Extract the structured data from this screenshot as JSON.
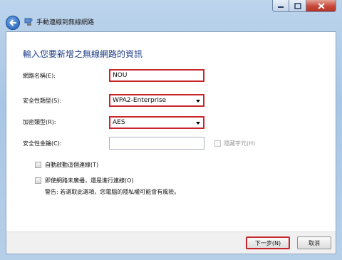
{
  "window": {
    "title": "手動連線到無線網路",
    "controls": [
      "minimize",
      "maximize",
      "close"
    ]
  },
  "heading": "輸入您要新增之無線網路的資訊",
  "form": {
    "network_name": {
      "label": "網路名稱(E):",
      "value": "NOU"
    },
    "security_type": {
      "label": "安全性類型(S):",
      "value": "WPA2-Enterprise"
    },
    "encryption_type": {
      "label": "加密類型(R):",
      "value": "AES"
    },
    "security_key": {
      "label": "安全性金鑰(C):",
      "value": ""
    },
    "hide_chars": {
      "label": "隱藏字元(H)",
      "checked": false,
      "enabled": false
    }
  },
  "options": {
    "auto_start": {
      "label": "自動啟動這個連線(T)",
      "checked": false
    },
    "connect_even_if_not_broadcasting": {
      "label": "即使網路未廣播，還是進行連線(O)",
      "checked": false
    },
    "warning": "警告: 若選取此選項，您電腦的隱私權可能會有風險。"
  },
  "buttons": {
    "next": "下一步(N)",
    "cancel": "取消"
  },
  "colors": {
    "highlight_border": "#c8262b",
    "heading_text": "#1f3f86",
    "frame": "#b6cfe9"
  },
  "icons": {
    "back": "back-arrow-icon",
    "network": "wireless-network-icon",
    "close": "close-icon",
    "minimize": "minimize-icon",
    "maximize": "maximize-icon",
    "dropdown": "chevron-down-icon"
  }
}
